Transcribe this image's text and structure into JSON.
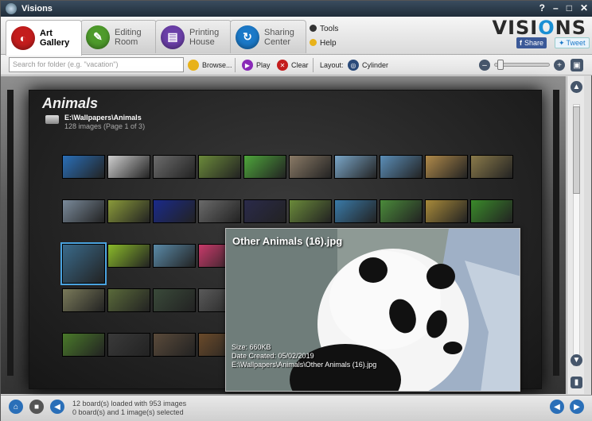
{
  "window": {
    "title": "Visions",
    "help": "?",
    "minimize": "–",
    "maximize": "□",
    "close": "✕"
  },
  "tabs": [
    {
      "label1": "Art",
      "label2": "Gallery",
      "icon": "palette-icon",
      "color": "#c41d1d"
    },
    {
      "label1": "Editing",
      "label2": "Room",
      "icon": "brush-icon",
      "color": "#4e9b2b"
    },
    {
      "label1": "Printing",
      "label2": "House",
      "icon": "printer-icon",
      "color": "#6b3fa8"
    },
    {
      "label1": "Sharing",
      "label2": "Center",
      "icon": "share-icon",
      "color": "#1b79c8"
    }
  ],
  "ribbon_links": {
    "tools": "Tools",
    "help": "Help"
  },
  "logo": {
    "pre": "VISI",
    "o": "O",
    "post": "NS"
  },
  "social": {
    "share": "Share",
    "tweet": "Tweet"
  },
  "toolbar": {
    "search_placeholder": "Search for folder (e.g. \"vacation\")",
    "browse": "Browse...",
    "play": "Play",
    "clear": "Clear",
    "layout_label": "Layout:",
    "layout_value": "Cylinder",
    "zoom_level": 0.05
  },
  "board": {
    "title": "Animals",
    "path": "E:\\Wallpapers\\Animals",
    "count": "128 images (Page 1 of 3)"
  },
  "thumb_colors": [
    [
      "#2a6fb8",
      "#cfcfcf",
      "#6c6c6c",
      "#6b8a3a",
      "#4ea63b",
      "#8a7a66",
      "#7aa6c8",
      "#5b8eb8",
      "#b08a4a",
      "#8a7a4a"
    ],
    [
      "#7a8a9a",
      "#8a9a3a",
      "#1a2a8a",
      "#6a6a6a",
      "#2a2a4a",
      "#6a8a3a",
      "#3a7aa8",
      "#4a8a3a",
      "#a88a3a",
      "#3a8a2a"
    ],
    [
      "#3a6a8a",
      "#8aba2a",
      "#5a8aa8",
      "#c83a6a"
    ],
    [
      "#7a7a5a",
      "#5a6a3a",
      "#3a4a3a",
      "#5a5a5a",
      "#d8d8d8"
    ],
    [
      "#4a7a2a",
      "#3a3a3a",
      "#5a4a3a",
      "#6a4a2a"
    ]
  ],
  "preview": {
    "title": "Other Animals (16).jpg",
    "size": "Size: 660KB",
    "date": "Date Created: 05/02/2019",
    "path": "E:\\Wallpapers\\Animals\\Other Animals (16).jpg"
  },
  "status": {
    "line1": "12 board(s) loaded with 953 images",
    "line2": "0 board(s) and 1 image(s) selected"
  }
}
